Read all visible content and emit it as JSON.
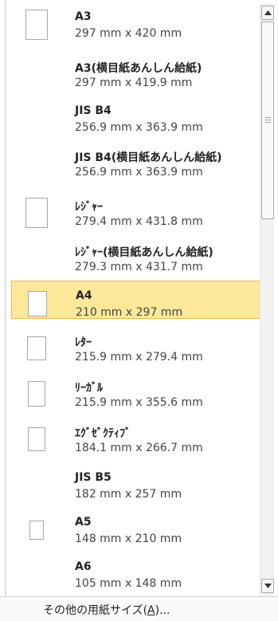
{
  "paper_sizes": [
    {
      "name": "A3",
      "size": "297 mm x 420 mm",
      "has_thumb": true,
      "selected": false
    },
    {
      "name": "A3(横目紙あんしん給紙)",
      "size": "297 mm x 419.9 mm",
      "has_thumb": false,
      "selected": false
    },
    {
      "name": "JIS B4",
      "size": "256.9 mm x 363.9 mm",
      "has_thumb": false,
      "selected": false
    },
    {
      "name": "JIS B4(横目紙あんしん給紙)",
      "size": "256.9 mm x 363.9 mm",
      "has_thumb": false,
      "selected": false
    },
    {
      "name": "ﾚｼﾞｬｰ",
      "size": "279.4 mm x 431.8 mm",
      "has_thumb": true,
      "selected": false
    },
    {
      "name": "ﾚｼﾞｬｰ(横目紙あんしん給紙)",
      "size": "279.3 mm x 431.7 mm",
      "has_thumb": false,
      "selected": false
    },
    {
      "name": "A4",
      "size": "210 mm x 297 mm",
      "has_thumb": true,
      "selected": true
    },
    {
      "name": "ﾚﾀｰ",
      "size": "215.9 mm x 279.4 mm",
      "has_thumb": true,
      "selected": false
    },
    {
      "name": "ﾘｰｶﾞﾙ",
      "size": "215.9 mm x 355.6 mm",
      "has_thumb": true,
      "selected": false
    },
    {
      "name": "ｴｸﾞｾﾞｸﾃｨﾌﾞ",
      "size": "184.1 mm x 266.7 mm",
      "has_thumb": true,
      "selected": false
    },
    {
      "name": "JIS B5",
      "size": "182 mm x 257 mm",
      "has_thumb": false,
      "selected": false
    },
    {
      "name": "A5",
      "size": "148 mm x 210 mm",
      "has_thumb": true,
      "selected": false
    },
    {
      "name": "A6",
      "size": "105 mm x 148 mm",
      "has_thumb": false,
      "selected": false
    }
  ],
  "footer": {
    "label_prefix": "その他の用紙サイズ(",
    "accelerator": "A",
    "label_suffix": ")..."
  },
  "scrollbar": {
    "up_icon": "scroll-up-arrow",
    "down_icon": "scroll-down-arrow",
    "colors": {
      "selected_fill": "#fde89a",
      "selected_border": "#f0b94f"
    }
  }
}
